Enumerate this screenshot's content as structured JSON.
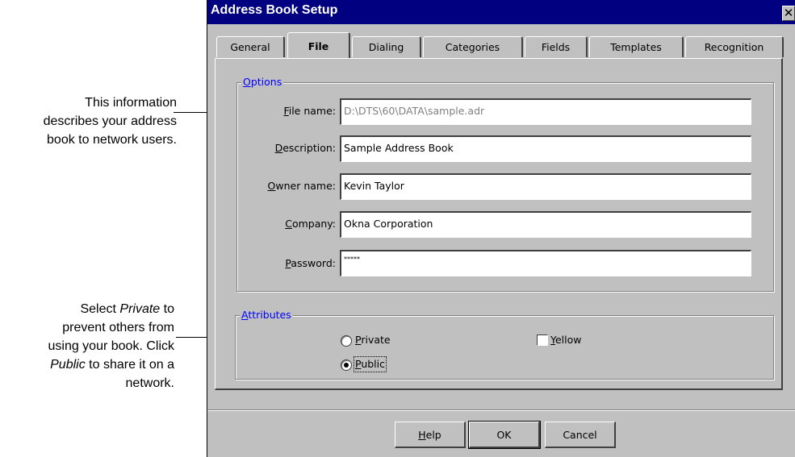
{
  "callouts": {
    "info": [
      "This information",
      "describes your address",
      "book to network users."
    ],
    "private": {
      "line1_em": "Private",
      "line1_rest": " to",
      "line1_pre": "Select ",
      "line2": "prevent others from",
      "line3": "using your book. Click",
      "line4_em": "Public",
      "line4_rest": " to share it on a",
      "line5": "network."
    }
  },
  "dialog": {
    "title": "Address Book Setup",
    "close_glyph": "✕",
    "tabs": [
      "General",
      "File",
      "Dialing",
      "Categories",
      "Fields",
      "Templates",
      "Recognition"
    ],
    "active_tab": "File"
  },
  "options": {
    "legend_key": "O",
    "legend_rest": "ptions",
    "fields": [
      {
        "key": "F",
        "rest": "ile name:",
        "value": "D:\\DTS\\60\\DATA\\sample.adr",
        "disabled": true
      },
      {
        "key": "D",
        "rest": "escription:",
        "value": "Sample Address Book"
      },
      {
        "key": "O",
        "rest": "wner name:",
        "value": "Kevin Taylor"
      },
      {
        "key": "C",
        "rest": "ompany:",
        "value": "Okna Corporation"
      },
      {
        "key": "P",
        "rest": "assword:",
        "value": "*****"
      }
    ]
  },
  "attributes": {
    "legend_key": "A",
    "legend_rest": "ttributes",
    "private": {
      "key": "P",
      "rest": "rivate",
      "checked": false
    },
    "public": {
      "key": "P",
      "rest": "ublic",
      "checked": true
    },
    "yellow": {
      "key": "Y",
      "rest": "ellow",
      "checked": false
    }
  },
  "buttons": {
    "help": {
      "key": "H",
      "rest": "elp"
    },
    "ok": "OK",
    "cancel": "Cancel"
  }
}
